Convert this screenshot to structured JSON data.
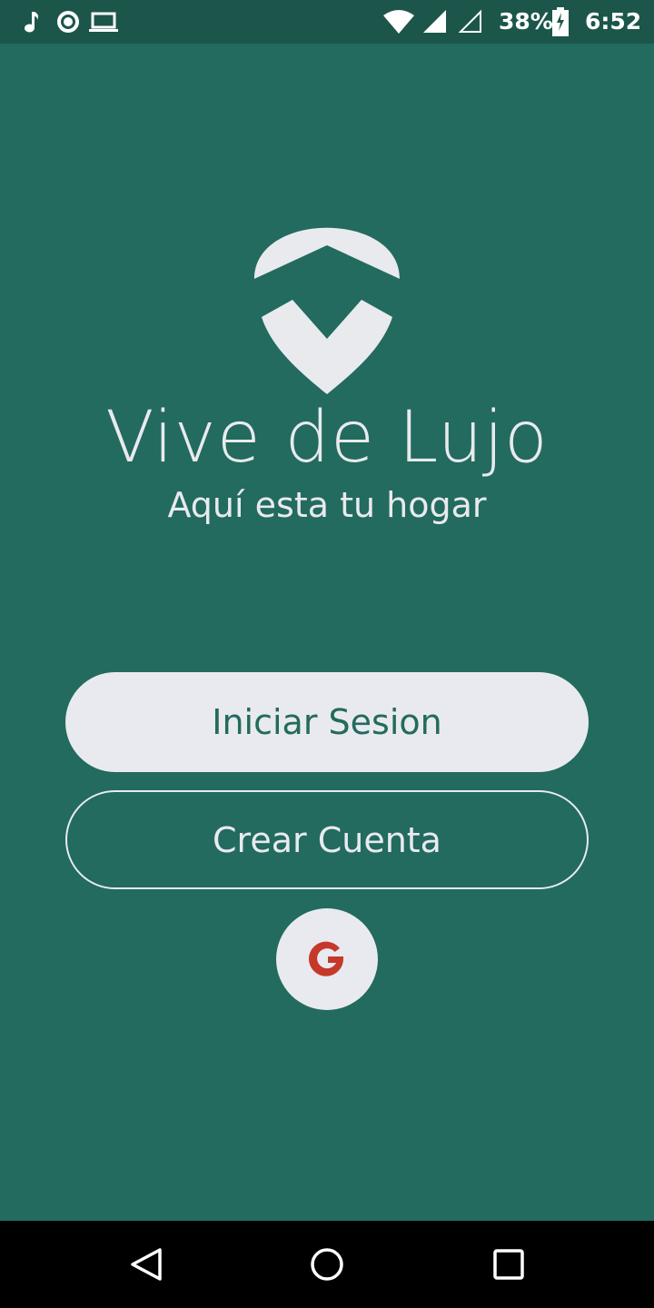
{
  "status_bar": {
    "battery_percent": "38%",
    "time": "6:52",
    "icons": [
      "music-note-icon",
      "record-icon",
      "laptop-icon",
      "wifi-icon",
      "signal-icon",
      "signal-empty-icon",
      "battery-charging-icon"
    ]
  },
  "main": {
    "title": "Vive de Lujo",
    "subtitle": "Aquí esta tu hogar",
    "login_button": "Iniciar Sesion",
    "register_button": "Crear Cuenta",
    "google_icon": "google-icon"
  },
  "nav_bar": {
    "icons": [
      "back-icon",
      "home-icon",
      "recents-icon"
    ]
  },
  "colors": {
    "background": "#226b5e",
    "status_bar": "#1c564b",
    "foreground": "#e9eaef",
    "google_red": "#c5382a"
  }
}
